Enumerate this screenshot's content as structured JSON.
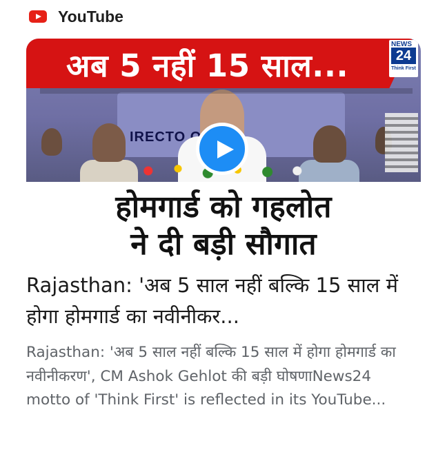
{
  "source": {
    "icon": "youtube-logo-icon",
    "name": "YouTube",
    "brand_color": "#e62117"
  },
  "thumbnail": {
    "banner_text": "अब 5 नहीं 15 साल...",
    "banner_color": "#d61313",
    "channel_logo": {
      "top": "NEWS",
      "number": "24",
      "tagline": "Think First"
    },
    "board_text": "IRECTO   OME",
    "headline_line1": "होमगार्ड को गहलोत",
    "headline_line2": "ने दी बड़ी सौगात",
    "play_icon": "play-icon",
    "play_color": "#1d8df5"
  },
  "card": {
    "title": "Rajasthan: 'अब 5 साल नहीं बल्कि 15 साल में होगा होमगार्ड का नवीनीकर...",
    "description": "Rajasthan: 'अब 5 साल नहीं बल्कि 15 साल में होगा होमगार्ड का नवीनीकरण', CM Ashok Gehlot की बड़ी घोषणाNews24 motto of 'Think First' is reflected in its YouTube..."
  }
}
